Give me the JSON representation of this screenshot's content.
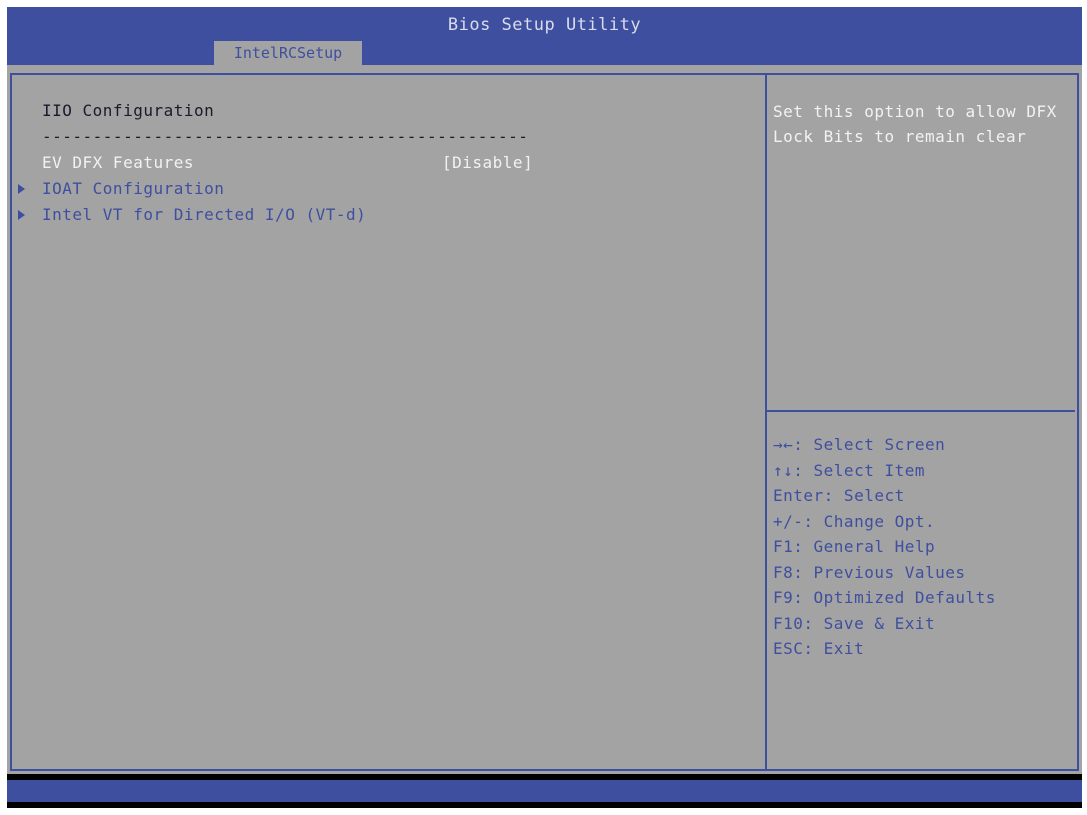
{
  "window": {
    "title": "Bios Setup Utility",
    "tab": "IntelRCSetup"
  },
  "main": {
    "heading": "IIO Configuration",
    "rule": "------------------------------------------------",
    "items": [
      {
        "label": "EV DFX Features",
        "value": "[Disable]",
        "type": "option"
      },
      {
        "label": "IOAT Configuration",
        "type": "submenu"
      },
      {
        "label": "Intel VT for Directed I/O (VT-d)",
        "type": "submenu"
      }
    ]
  },
  "help": {
    "description": "Set this option to allow DFX Lock Bits to remain clear",
    "keys": [
      "→←: Select Screen",
      "↑↓: Select Item",
      "Enter: Select",
      "+/-: Change Opt.",
      "F1: General Help",
      "F8: Previous Values",
      "F9: Optimized Defaults",
      "F10: Save & Exit",
      "ESC: Exit"
    ]
  },
  "colors": {
    "accent": "#3f4f9f",
    "panel": "#a3a3a3",
    "highlight": "#f2f2f2"
  }
}
